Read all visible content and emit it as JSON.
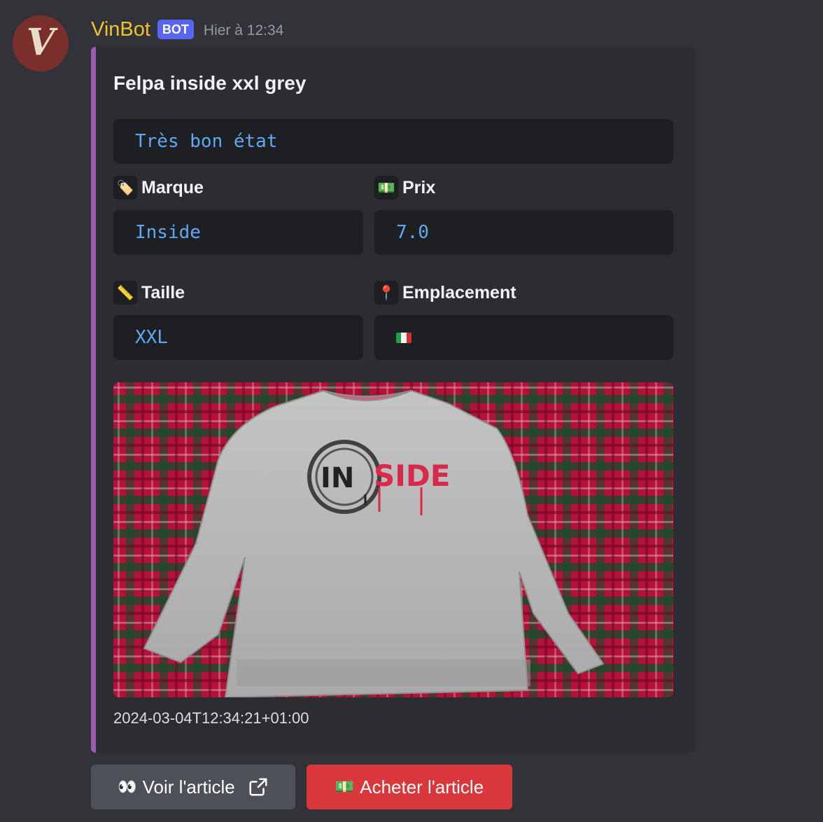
{
  "message": {
    "avatar_letter": "V",
    "username": "VinBot",
    "bot_tag": "BOT",
    "timestamp": "Hier à 12:34"
  },
  "embed": {
    "accent_color": "#9b59b6",
    "title": "Felpa inside xxl grey",
    "condition": "Très bon état",
    "fields": {
      "brand": {
        "emoji": "🏷️",
        "name": "Marque",
        "value": "Inside"
      },
      "price": {
        "emoji": "💵",
        "name": "Prix",
        "value": "7.0"
      },
      "size": {
        "emoji": "📏",
        "name": "Taille",
        "value": "XXL"
      },
      "location": {
        "emoji": "📍",
        "name": "Emplacement",
        "flag": "italy-flag"
      }
    },
    "image": {
      "logo_text_left": "IN",
      "logo_text_right": "SIDE"
    },
    "footer_timestamp": "2024-03-04T12:34:21+01:00"
  },
  "buttons": {
    "view": {
      "emoji": "👀",
      "label": "Voir l'article",
      "icon": "external-link-icon"
    },
    "buy": {
      "emoji": "💵",
      "label": "Acheter l'article"
    }
  },
  "colors": {
    "background": "#313338",
    "embed_bg": "#2b2d31",
    "username": "#f0c22e",
    "bot_tag": "#5865f2",
    "code_text": "#5fa8f5",
    "button_secondary": "#4e5058",
    "button_danger": "#da373c"
  }
}
